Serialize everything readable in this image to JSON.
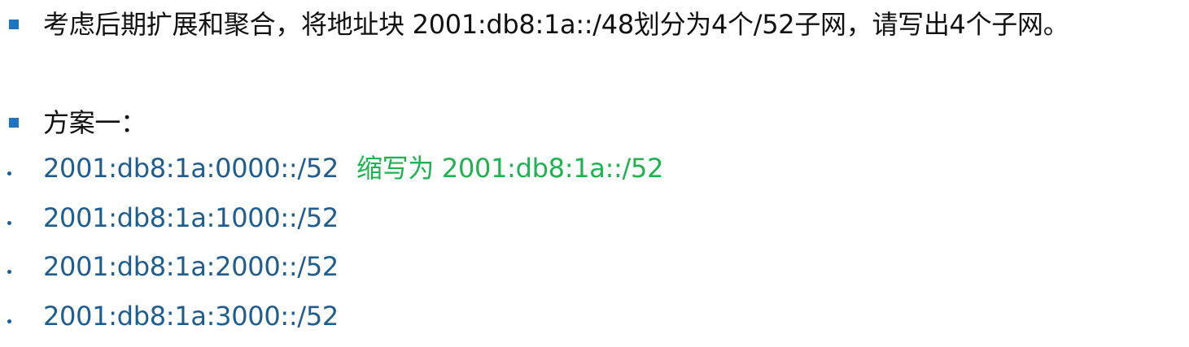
{
  "colors": {
    "bullet_square": "#1b74c4",
    "bullet_dot": "#1f5c8f",
    "text_dark": "#111111",
    "text_blue": "#1f5c8f",
    "text_green": "#1fb34f"
  },
  "question": {
    "text": "考虑后期扩展和聚合，将地址块 2001:db8:1a::/48划分为4个/52子网，请写出4个子网。"
  },
  "plan": {
    "heading": "方案一：",
    "subnets": [
      {
        "address": "2001:db8:1a:0000::/52",
        "note": "缩写为 2001:db8:1a::/52"
      },
      {
        "address": "2001:db8:1a:1000::/52"
      },
      {
        "address": "2001:db8:1a:2000::/52"
      },
      {
        "address": "2001:db8:1a:3000::/52"
      }
    ]
  }
}
